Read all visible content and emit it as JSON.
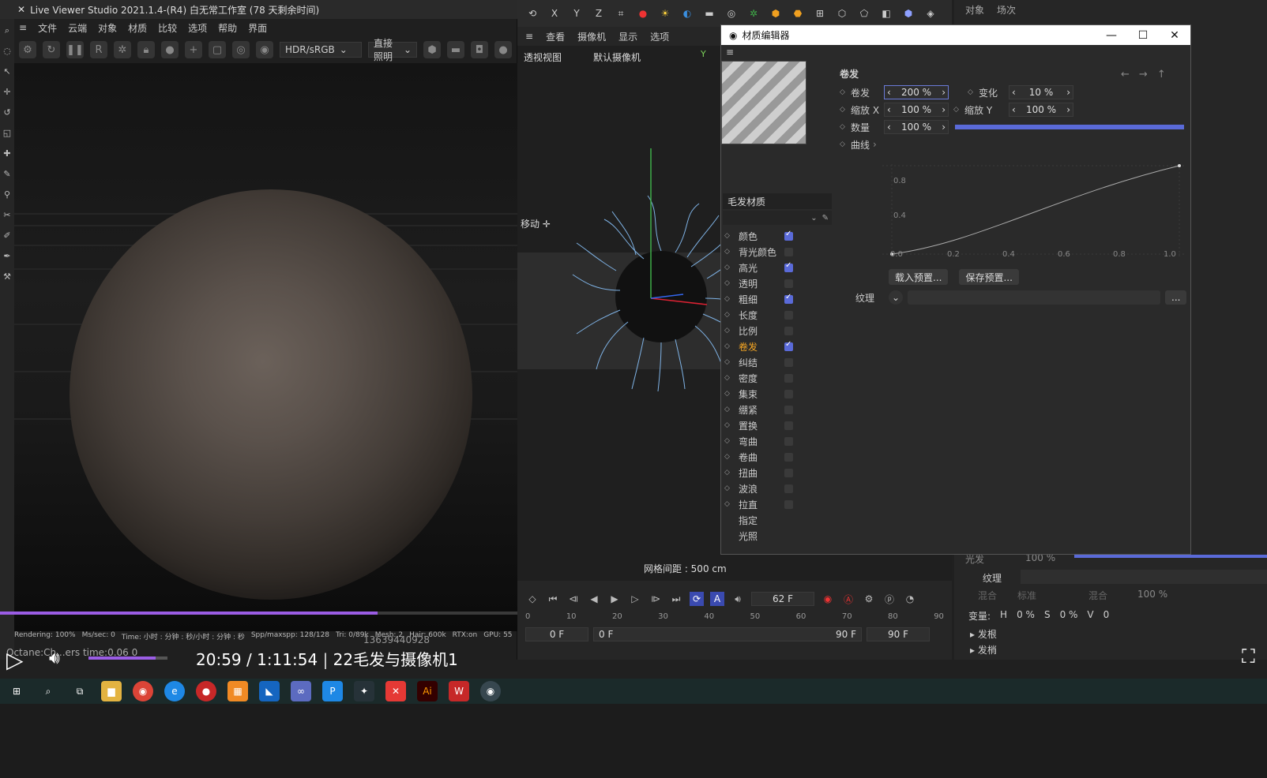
{
  "liveviewer": {
    "title": "Live Viewer Studio 2021.1.4-(R4)  白无常工作室 (78 天剩余时间)",
    "menu": [
      "文件",
      "云端",
      "对象",
      "材质",
      "比较",
      "选项",
      "帮助",
      "界面"
    ],
    "color_mode": "HDR/sRGB",
    "lighting_mode": "直接照明",
    "status": [
      "Rendering: 100%",
      "Ms/sec: 0",
      "Time: 小时 : 分钟 : 秒/小时 : 分钟 : 秒",
      "Spp/maxspp: 128/128",
      "Tri: 0/89k",
      "Mesh: 2",
      "Hair: 600k",
      "RTX:on",
      "GPU: 55"
    ],
    "progress_percent": 73
  },
  "viewport": {
    "axes": [
      "X",
      "Y",
      "Z"
    ],
    "menu": [
      "查看",
      "摄像机",
      "显示",
      "选项"
    ],
    "view_label": "透视视图",
    "camera_label": "默认摄像机",
    "move_label": "移动",
    "y_axis": "Y",
    "grid_info": "网格间距 : 500 cm",
    "timeline": {
      "current_frame": "62 F",
      "ruler": [
        "0",
        "10",
        "20",
        "30",
        "40",
        "50",
        "60",
        "70",
        "80",
        "90"
      ],
      "start": "0 F",
      "start2": "0 F",
      "end": "90 F",
      "end2": "90 F"
    }
  },
  "material_editor": {
    "title": "材质编辑器",
    "material_name": "毛发材质",
    "section_title": "卷发",
    "channels": [
      {
        "label": "颜色",
        "checked": true
      },
      {
        "label": "背光颜色",
        "checked": false
      },
      {
        "label": "高光",
        "checked": true
      },
      {
        "label": "透明",
        "checked": false
      },
      {
        "label": "粗细",
        "checked": true
      },
      {
        "label": "长度",
        "checked": false
      },
      {
        "label": "比例",
        "checked": false
      },
      {
        "label": "卷发",
        "checked": true,
        "active": true
      },
      {
        "label": "纠结",
        "checked": false
      },
      {
        "label": "密度",
        "checked": false
      },
      {
        "label": "集束",
        "checked": false
      },
      {
        "label": "绷紧",
        "checked": false
      },
      {
        "label": "置换",
        "checked": false
      },
      {
        "label": "弯曲",
        "checked": false
      },
      {
        "label": "卷曲",
        "checked": false
      },
      {
        "label": "扭曲",
        "checked": false
      },
      {
        "label": "波浪",
        "checked": false
      },
      {
        "label": "拉直",
        "checked": false
      }
    ],
    "extra_channels": [
      "指定",
      "光照"
    ],
    "params": {
      "curl_label": "卷发",
      "curl_value": "200 %",
      "variation_label": "变化",
      "variation_value": "10 %",
      "scale_x_label": "缩放 X",
      "scale_x_value": "100 %",
      "scale_y_label": "缩放 Y",
      "scale_y_value": "100 %",
      "amount_label": "数量",
      "amount_value": "100 %",
      "amount_fraction": 1.0,
      "curve_label": "曲线",
      "texture_label": "纹理"
    },
    "curve_axis": {
      "y": [
        "0.8",
        "0.4"
      ],
      "x": [
        "0.0",
        "0.2",
        "0.4",
        "0.6",
        "0.8",
        "1.0"
      ]
    },
    "buttons": {
      "load_preset": "载入预置...",
      "save_preset": "保存预置...",
      "more": "..."
    }
  },
  "right_panel": {
    "tabs": [
      "对象",
      "场次"
    ],
    "texture_label": "纹理",
    "blend_label": "混合",
    "blend_mode": "标准",
    "blend_label2": "混合",
    "blend_value": "100 %",
    "variation_label": "变量:",
    "h_label": "H",
    "h_value": "0 %",
    "s_label": "S",
    "s_value": "0 %",
    "v_label": "V",
    "v_value": "0",
    "root_label": "发根",
    "tip_label": "发梢",
    "partial_value": "100 %",
    "partial_label": "光发"
  },
  "player": {
    "time": "20:59 / 1:11:54",
    "title": "22毛发与摄像机1",
    "overlay_text": "Octane:Ch...ers time:0.06 0",
    "id_text": "13639440928",
    "volume_fraction": 0.85
  },
  "taskbar_icons": [
    "file-explorer",
    "chrome",
    "edge",
    "record",
    "app",
    "app2",
    "app3",
    "app4",
    "app5",
    "app6",
    "adobe-illustrator",
    "wps",
    "cinema4d"
  ]
}
